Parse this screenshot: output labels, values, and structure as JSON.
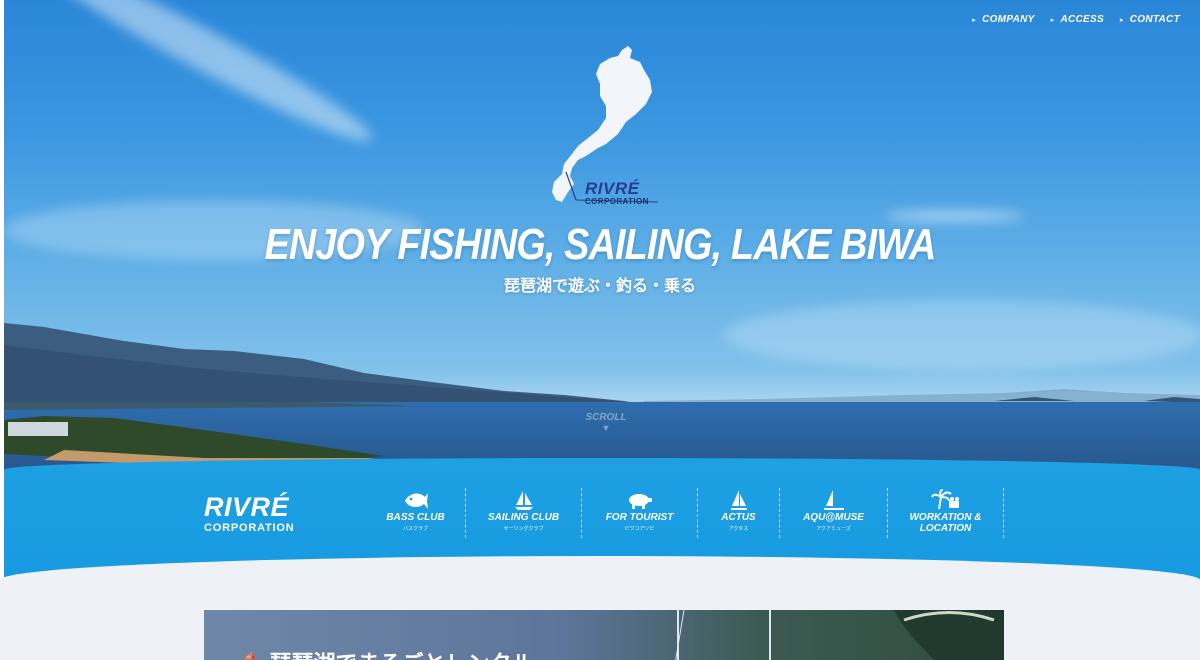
{
  "top_nav": [
    {
      "label": "COMPANY"
    },
    {
      "label": "ACCESS"
    },
    {
      "label": "CONTACT"
    }
  ],
  "brand": {
    "name": "RIVRÉ",
    "subtitle": "CORPORATION"
  },
  "hero": {
    "headline": "ENJOY FISHING, SAILING, LAKE BIWA",
    "subheadline": "琵琶湖で遊ぶ・釣る・乗る",
    "scroll_label": "SCROLL"
  },
  "menu": [
    {
      "label": "BASS CLUB",
      "sub": "バスクラブ",
      "icon": "fish-icon"
    },
    {
      "label": "SAILING CLUB",
      "sub": "セーリングクラブ",
      "icon": "sailboat-icon"
    },
    {
      "label": "FOR TOURIST",
      "sub": "ビワコアソビ",
      "icon": "pig-icon"
    },
    {
      "label": "ACTUS",
      "sub": "アクタス",
      "icon": "sail-icon"
    },
    {
      "label": "AQU@MUSE",
      "sub": "アクアミューズ",
      "icon": "sail-icon"
    },
    {
      "label": "WORKATION & LOCATION",
      "sub": "",
      "icon": "palm-camera-icon"
    }
  ],
  "banner": {
    "text": "琵琶湖でまるごとレンタル"
  },
  "colors": {
    "sky": "#3b97e0",
    "menu_band": "#1ea0e3",
    "brand_navy": "#2a3d8f",
    "lower_bg": "#eef2f6"
  }
}
